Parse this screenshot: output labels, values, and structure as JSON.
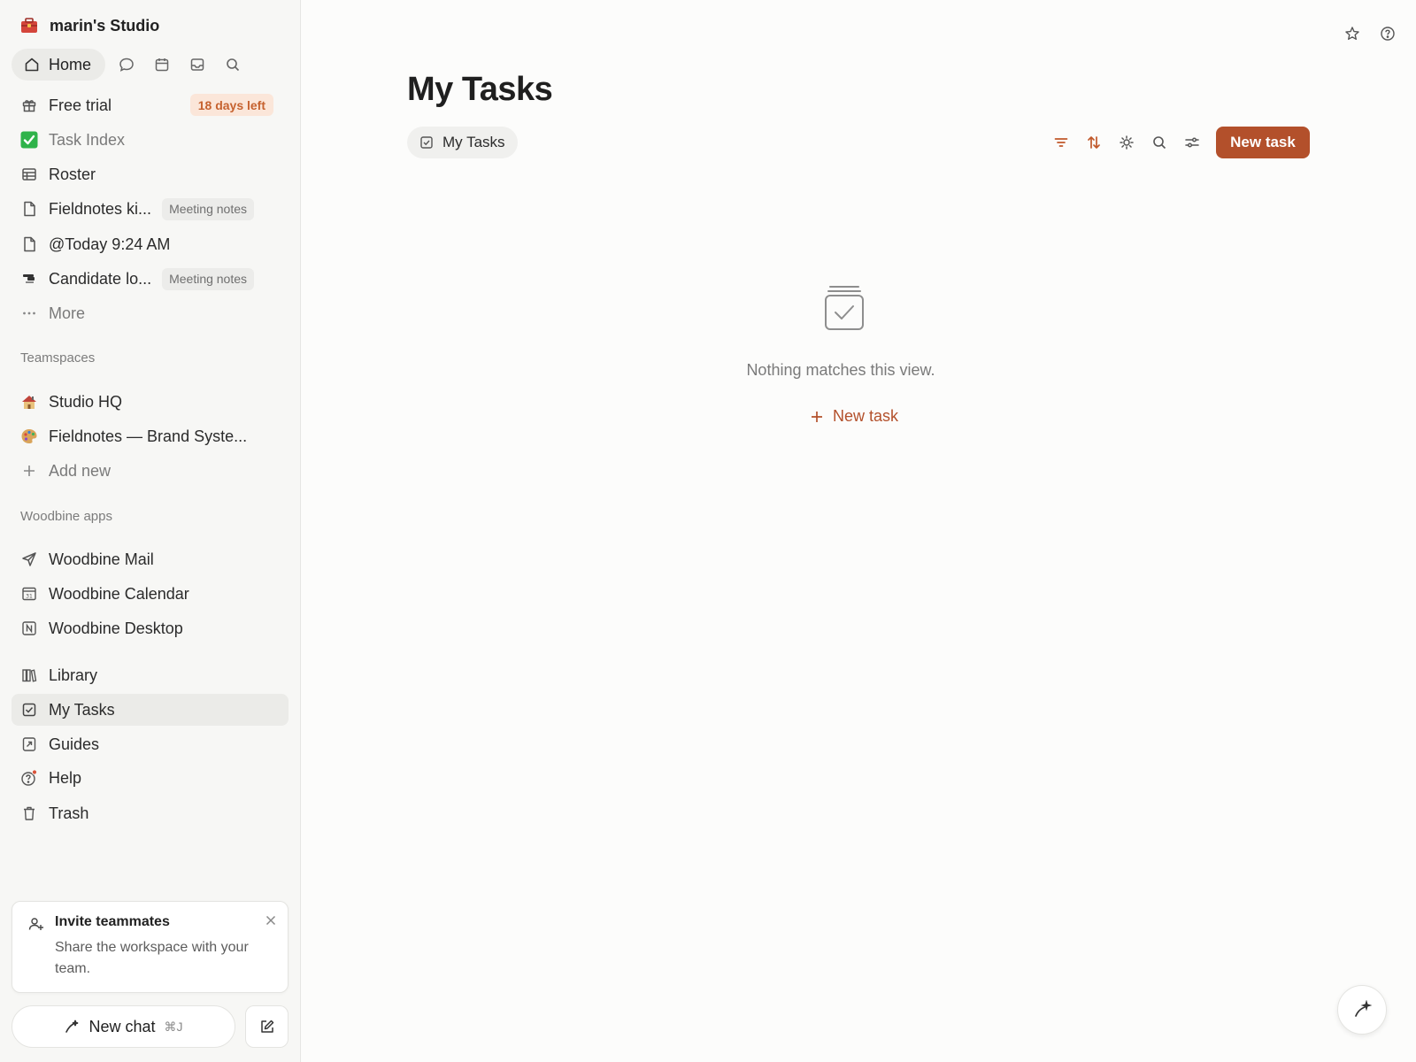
{
  "workspace": {
    "name": "marin's Studio",
    "icon": "toolbox-icon"
  },
  "top_nav": {
    "home_label": "Home",
    "icons": [
      "chat-icon",
      "calendar-icon",
      "inbox-icon",
      "search-icon"
    ]
  },
  "sidebar": {
    "items": [
      {
        "label": "Free trial",
        "icon": "gift-icon",
        "badge": "18 days left"
      },
      {
        "label": "Task Index",
        "icon": "green-check-icon"
      },
      {
        "label": "Roster",
        "icon": "table-icon"
      },
      {
        "label": "Fieldnotes ki...",
        "icon": "page-icon",
        "tag": "Meeting notes"
      },
      {
        "label": "@Today 9:24 AM",
        "icon": "page-icon"
      },
      {
        "label": "Candidate lo...",
        "icon": "stamp-icon",
        "tag": "Meeting notes"
      },
      {
        "label": "More",
        "icon": "ellipsis-icon"
      }
    ],
    "teamspaces_label": "Teamspaces",
    "teamspaces": [
      {
        "label": "Studio HQ",
        "icon": "house-icon"
      },
      {
        "label": "Fieldnotes — Brand Syste...",
        "icon": "palette-icon"
      },
      {
        "label": "Add new",
        "icon": "plus-icon"
      }
    ],
    "apps_label": "Woodbine apps",
    "apps": [
      {
        "label": "Woodbine Mail",
        "icon": "send-icon"
      },
      {
        "label": "Woodbine Calendar",
        "icon": "calendar-icon"
      },
      {
        "label": "Woodbine Desktop",
        "icon": "desktop-app-icon"
      }
    ],
    "bottom_items": [
      {
        "label": "Library",
        "icon": "library-icon"
      },
      {
        "label": "My Tasks",
        "icon": "checkbox-icon",
        "active": true
      },
      {
        "label": "Guides",
        "icon": "guides-icon"
      },
      {
        "label": "Help",
        "icon": "help-icon"
      },
      {
        "label": "Trash",
        "icon": "trash-icon"
      }
    ],
    "invite": {
      "title": "Invite teammates",
      "description": "Share the workspace with your team."
    },
    "new_chat": {
      "label": "New chat",
      "shortcut": "⌘J"
    }
  },
  "main": {
    "title": "My Tasks",
    "view_tab": "My Tasks",
    "toolbar_icons": [
      "filter-icon",
      "sort-icon",
      "automation-icon",
      "search-icon",
      "settings-sliders-icon"
    ],
    "new_task_button": "New task",
    "empty_state": {
      "message": "Nothing matches this view.",
      "action": "New task"
    }
  },
  "colors": {
    "accent": "#b3502b",
    "badge_bg": "#fbe6d9",
    "badge_text": "#c6622f",
    "sidebar_bg": "#f7f7f5"
  }
}
